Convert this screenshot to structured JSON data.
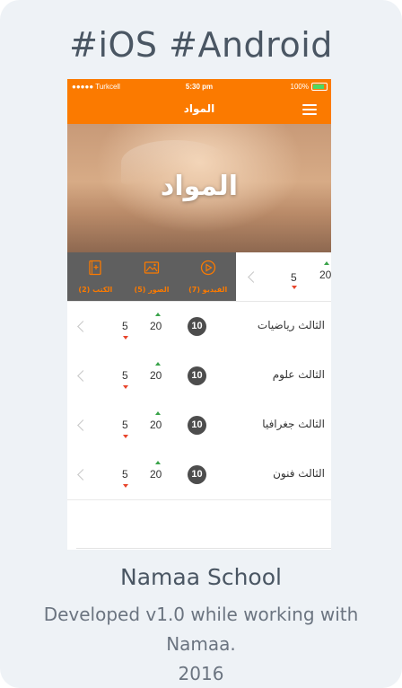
{
  "headline": "#iOS #Android",
  "status_bar": {
    "carrier": "●●●●● Turkcell",
    "time": "5:30 pm",
    "battery": "100%"
  },
  "nav": {
    "title": "المواد",
    "menu_icon": "hamburger-menu-icon"
  },
  "hero": {
    "title": "المواد"
  },
  "swipe_row": {
    "actions": [
      {
        "label": "الفيديو (7)",
        "icon": "play-circle-icon"
      },
      {
        "label": "الصور (5)",
        "icon": "image-icon"
      },
      {
        "label": "الكتب (2)",
        "icon": "book-icon"
      }
    ],
    "down_value": "5",
    "up_value": "20"
  },
  "rows": [
    {
      "name": "الثالث رياضيات",
      "badge": "10",
      "up": "20",
      "down": "5"
    },
    {
      "name": "الثالث علوم",
      "badge": "10",
      "up": "20",
      "down": "5"
    },
    {
      "name": "الثالث جغرافيا",
      "badge": "10",
      "up": "20",
      "down": "5"
    },
    {
      "name": "الثالث فنون",
      "badge": "10",
      "up": "20",
      "down": "5"
    }
  ],
  "footer": {
    "title": "Namaa School",
    "description": "Developed v1.0 while working with Namaa.",
    "year": "2016"
  },
  "colors": {
    "accent": "#fb7a00",
    "up": "#3aa34a",
    "down": "#e8452c",
    "badge": "#4d4d4d"
  }
}
